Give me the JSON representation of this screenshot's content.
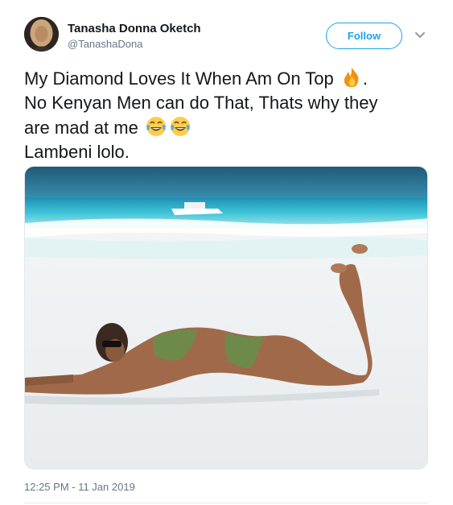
{
  "user": {
    "display_name": "Tanasha Donna Oketch",
    "handle": "@TanashaDona",
    "avatar_icon": "user-avatar"
  },
  "follow_button": {
    "label": "Follow"
  },
  "more_menu": {
    "icon": "chevron-down-icon"
  },
  "tweet": {
    "line1_text": "My Diamond Loves It When Am On Top ",
    "line1_emoji": "fire-emoji",
    "line1_end": ".",
    "line2_text": "No Kenyan Men can do That, Thats why they",
    "line3_text": "are mad at me ",
    "line3_emojis": [
      "tears-of-joy-emoji",
      "tears-of-joy-emoji"
    ],
    "line4_text": "Lambeni lolo."
  },
  "media": {
    "type": "photo"
  },
  "timestamp": "12:25 PM - 11 Jan 2019",
  "colors": {
    "accent": "#1da1f2",
    "secondary_text": "#657786",
    "primary_text": "#14171a"
  }
}
